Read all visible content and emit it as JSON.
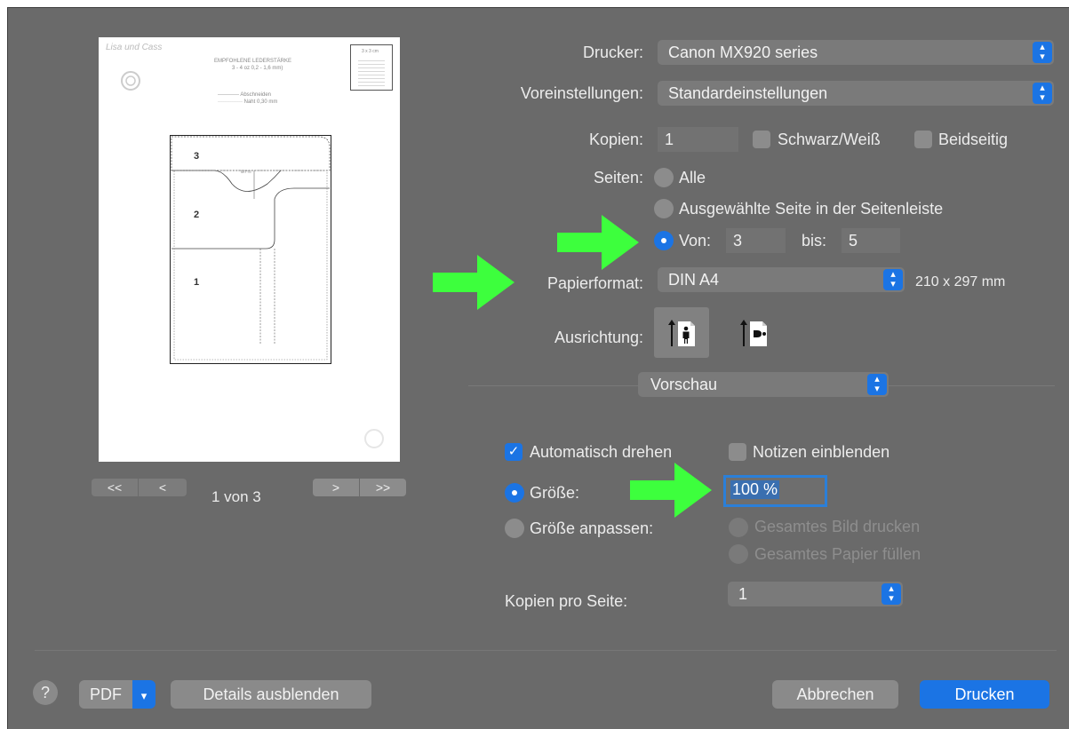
{
  "printer": {
    "label": "Drucker:",
    "value": "Canon MX920 series"
  },
  "presets": {
    "label": "Voreinstellungen:",
    "value": "Standardeinstellungen"
  },
  "copies": {
    "label": "Kopien:",
    "value": "1",
    "bw_label": "Schwarz/Weiß",
    "duplex_label": "Beidseitig"
  },
  "pages": {
    "label": "Seiten:",
    "all_label": "Alle",
    "selection_label": "Ausgewählte Seite in der Seitenleiste",
    "from_label": "Von:",
    "from_value": "3",
    "to_label": "bis:",
    "to_value": "5"
  },
  "paper": {
    "label": "Papierformat:",
    "value": "DIN A4",
    "size": "210 x 297 mm"
  },
  "orientation": {
    "label": "Ausrichtung:"
  },
  "section": {
    "value": "Vorschau"
  },
  "preview_options": {
    "auto_rotate": "Automatisch drehen",
    "show_notes": "Notizen einblenden",
    "size_label": "Größe:",
    "size_value": "100 %",
    "fit_label": "Größe anpassen:",
    "print_image": "Gesamtes Bild drucken",
    "fill_paper": "Gesamtes Papier füllen",
    "per_page_label": "Kopien pro Seite:",
    "per_page_value": "1"
  },
  "preview_nav": {
    "first": "<<",
    "prev": "<",
    "page_status": "1 von 3",
    "next": ">",
    "last": ">>"
  },
  "preview_page": {
    "logo": "Lisa und Cass",
    "heading": "EMPFOHLENE LEDERSTÄRKE",
    "heading_sub": "3 - 4 oz 0,2 - 1,6 mm)",
    "legend_cut": "------------ Abschneiden",
    "legend_seam": "·············· Naht 0,30 mm",
    "box_text": "3 x 3 cm",
    "piece_1": "1",
    "piece_2": "2",
    "piece_3": "3",
    "mark": "MITTE"
  },
  "footer": {
    "help": "?",
    "pdf": "PDF",
    "details": "Details ausblenden",
    "cancel": "Abbrechen",
    "print": "Drucken"
  },
  "colors": {
    "accent": "#1b74e4",
    "arrow": "#3dff3d",
    "panel": "#6a6a6a"
  }
}
